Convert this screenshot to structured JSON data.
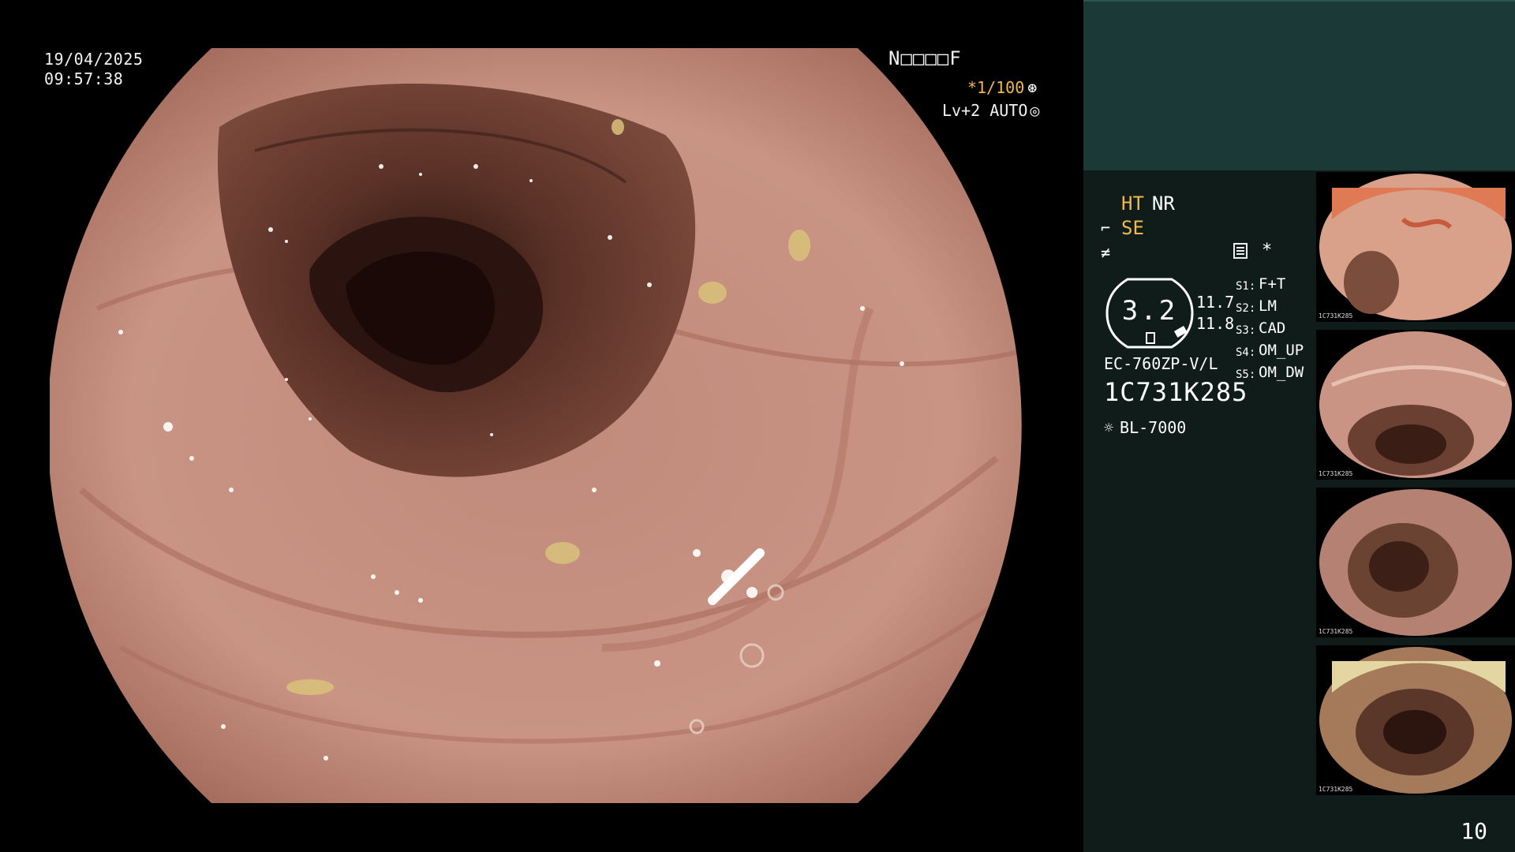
{
  "osd": {
    "date": "19/04/2025",
    "time": "09:57:38",
    "patient_id": "N□□□□F",
    "shutter": "*1/100",
    "shutter_icon": "aperture-icon",
    "agc": "Lv+2 AUTO",
    "agc_icon": "iris-auto-icon"
  },
  "panel": {
    "enhancement": {
      "ht": "HT",
      "nr": "NR"
    },
    "se_label": "SE",
    "iris_value": "3.2",
    "sub_values": [
      "11.7",
      "11.8"
    ],
    "switches": [
      {
        "key": "S1:",
        "value": "F+T"
      },
      {
        "key": "S2:",
        "value": "LM"
      },
      {
        "key": "S3:",
        "value": "CAD"
      },
      {
        "key": "S4:",
        "value": "OM_UP"
      },
      {
        "key": "S5:",
        "value": "OM_DW"
      }
    ],
    "scope_model": "EC-760ZP-V/L",
    "scope_serial": "1C731K285",
    "light_source": "BL-7000",
    "page_number": "10"
  },
  "thumbnails": [
    {
      "label": "1C731K285"
    },
    {
      "label": "1C731K285"
    },
    {
      "label": "1C731K285"
    },
    {
      "label": "1C731K285"
    }
  ],
  "colors": {
    "accent": "#f1b84a",
    "panel_background": "#0f1c1a",
    "panel_header": "#1b3a37",
    "mucosa": "#c98d7c",
    "lumen": "#4a2a22"
  }
}
